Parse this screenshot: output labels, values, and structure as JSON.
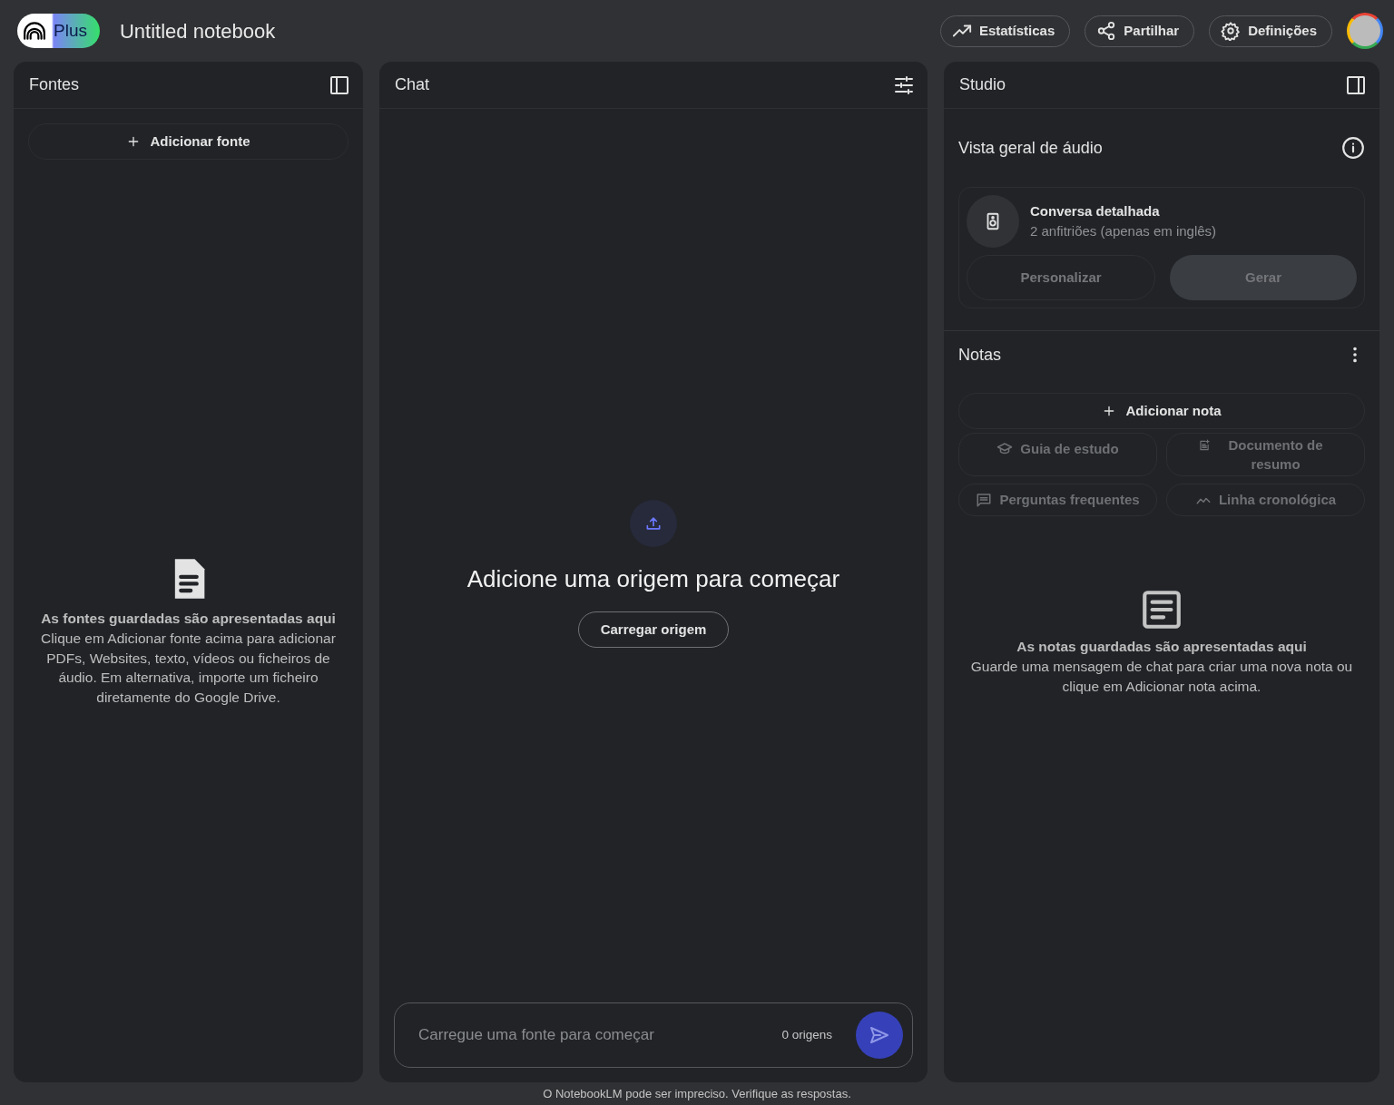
{
  "header": {
    "badge": "Plus",
    "title": "Untitled notebook",
    "buttons": [
      {
        "label": "Estatísticas"
      },
      {
        "label": "Partilhar"
      },
      {
        "label": "Definições"
      }
    ]
  },
  "sources": {
    "title": "Fontes",
    "add_button": "Adicionar fonte",
    "empty": {
      "heading": "As fontes guardadas são apresentadas aqui",
      "text": "Clique em Adicionar fonte acima para adicionar PDFs, Websites, texto, vídeos ou ficheiros de áudio. Em alternativa, importe um ficheiro diretamente do Google Drive."
    }
  },
  "chat": {
    "title": "Chat",
    "empty": {
      "heading": "Adicione uma origem para começar",
      "button": "Carregar origem"
    },
    "input": {
      "placeholder": "Carregue uma fonte para começar",
      "count": "0 origens"
    }
  },
  "studio": {
    "title": "Studio",
    "audio": {
      "heading": "Vista geral de áudio",
      "card": {
        "title": "Conversa detalhada",
        "subtitle": "2 anfitriões (apenas em inglês)"
      },
      "buttons": [
        {
          "label": "Personalizar",
          "kind": "outline",
          "disabled": true
        },
        {
          "label": "Gerar",
          "kind": "filled",
          "disabled": true
        }
      ]
    },
    "notes": {
      "heading": "Notas",
      "add_button": "Adicionar nota",
      "actions": [
        {
          "label": "Guia de estudo",
          "disabled": true
        },
        {
          "label": "Documento de resumo",
          "disabled": true
        },
        {
          "label": "Perguntas frequentes",
          "disabled": true
        },
        {
          "label": "Linha cronológica",
          "disabled": true
        }
      ],
      "empty": {
        "heading": "As notas guardadas são apresentadas aqui",
        "text": "Guarde uma mensagem de chat para criar uma nova nota ou clique em Adicionar nota acima."
      }
    }
  },
  "footer": "O NotebookLM pode ser impreciso. Verifique as respostas."
}
